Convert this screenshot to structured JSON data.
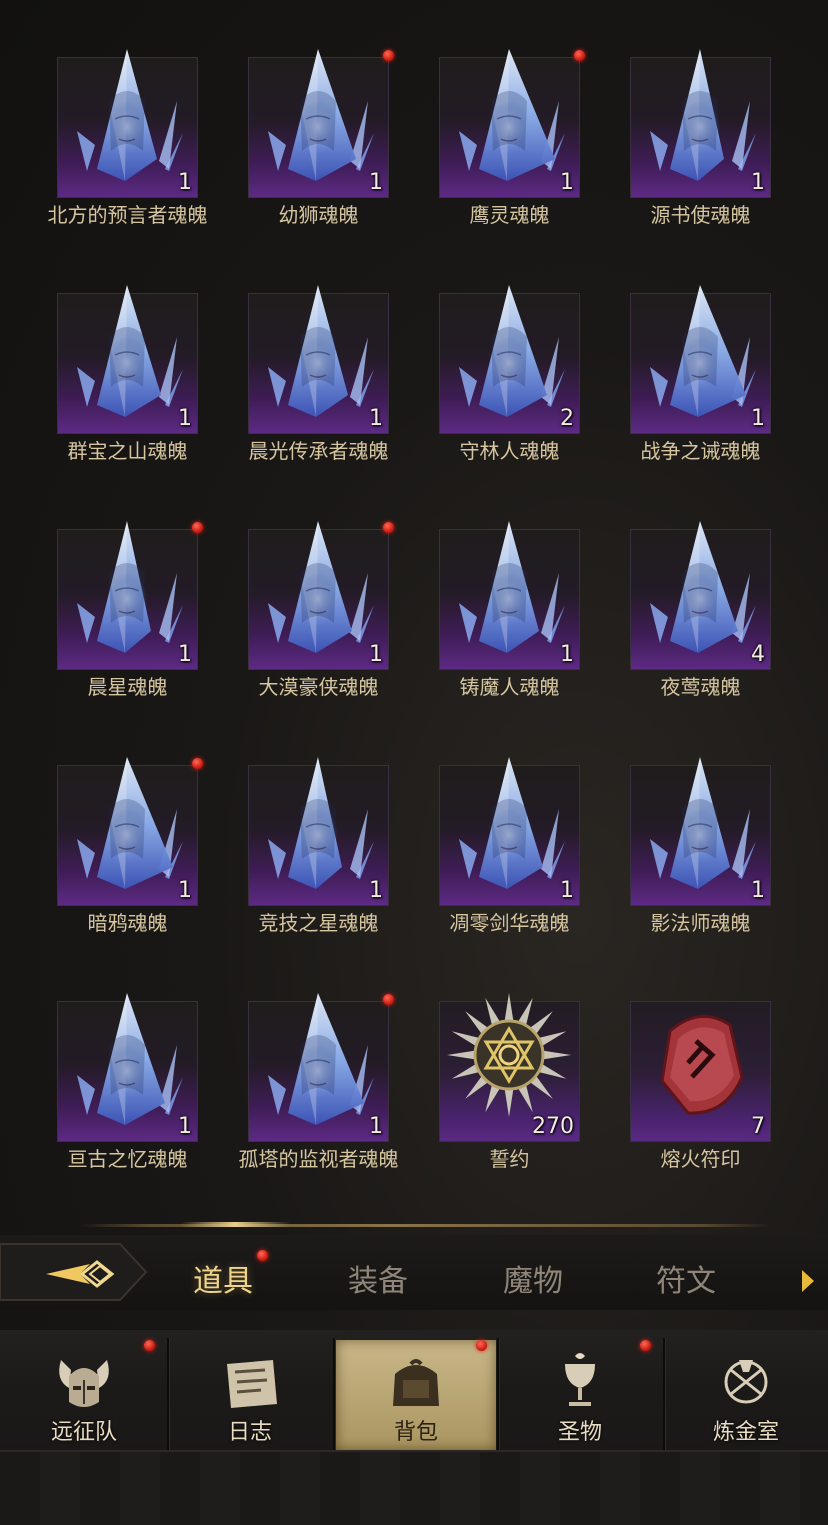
{
  "items": [
    {
      "name": "北方的预言者魂魄",
      "count": "1",
      "dot": false,
      "kind": "crystal"
    },
    {
      "name": "幼狮魂魄",
      "count": "1",
      "dot": true,
      "kind": "crystal"
    },
    {
      "name": "鹰灵魂魄",
      "count": "1",
      "dot": true,
      "kind": "crystal"
    },
    {
      "name": "源书使魂魄",
      "count": "1",
      "dot": false,
      "kind": "crystal"
    },
    {
      "name": "群宝之山魂魄",
      "count": "1",
      "dot": false,
      "kind": "crystal"
    },
    {
      "name": "晨光传承者魂魄",
      "count": "1",
      "dot": false,
      "kind": "crystal"
    },
    {
      "name": "守林人魂魄",
      "count": "2",
      "dot": false,
      "kind": "crystal"
    },
    {
      "name": "战争之诫魂魄",
      "count": "1",
      "dot": false,
      "kind": "crystal"
    },
    {
      "name": "晨星魂魄",
      "count": "1",
      "dot": true,
      "kind": "crystal"
    },
    {
      "name": "大漠豪侠魂魄",
      "count": "1",
      "dot": true,
      "kind": "crystal"
    },
    {
      "name": "铸魔人魂魄",
      "count": "1",
      "dot": false,
      "kind": "crystal"
    },
    {
      "name": "夜莺魂魄",
      "count": "4",
      "dot": false,
      "kind": "crystal"
    },
    {
      "name": "暗鸦魂魄",
      "count": "1",
      "dot": true,
      "kind": "crystal"
    },
    {
      "name": "竞技之星魂魄",
      "count": "1",
      "dot": false,
      "kind": "crystal"
    },
    {
      "name": "凋零剑华魂魄",
      "count": "1",
      "dot": false,
      "kind": "crystal"
    },
    {
      "name": "影法师魂魄",
      "count": "1",
      "dot": false,
      "kind": "crystal"
    },
    {
      "name": "亘古之忆魂魄",
      "count": "1",
      "dot": false,
      "kind": "crystal"
    },
    {
      "name": "孤塔的监视者魂魄",
      "count": "1",
      "dot": true,
      "kind": "crystal"
    },
    {
      "name": "誓约",
      "count": "270",
      "dot": false,
      "kind": "medal"
    },
    {
      "name": "熔火符印",
      "count": "7",
      "dot": false,
      "kind": "rune"
    }
  ],
  "tabs": [
    {
      "label": "道具",
      "active": true,
      "dot": true
    },
    {
      "label": "装备",
      "active": false,
      "dot": false
    },
    {
      "label": "魔物",
      "active": false,
      "dot": false
    },
    {
      "label": "符文",
      "active": false,
      "dot": false
    }
  ],
  "nav": [
    {
      "label": "远征队",
      "icon": "helmet-icon",
      "dot": true,
      "active": false
    },
    {
      "label": "日志",
      "icon": "scroll-icon",
      "dot": false,
      "active": false
    },
    {
      "label": "背包",
      "icon": "backpack-icon",
      "dot": true,
      "active": true
    },
    {
      "label": "圣物",
      "icon": "chalice-icon",
      "dot": true,
      "active": false
    },
    {
      "label": "炼金室",
      "icon": "alchemy-icon",
      "dot": false,
      "active": false
    }
  ],
  "colors": {
    "accent": "#f1d48b",
    "slot_purple": "#5e2a86",
    "badge_red": "#d01e12"
  }
}
